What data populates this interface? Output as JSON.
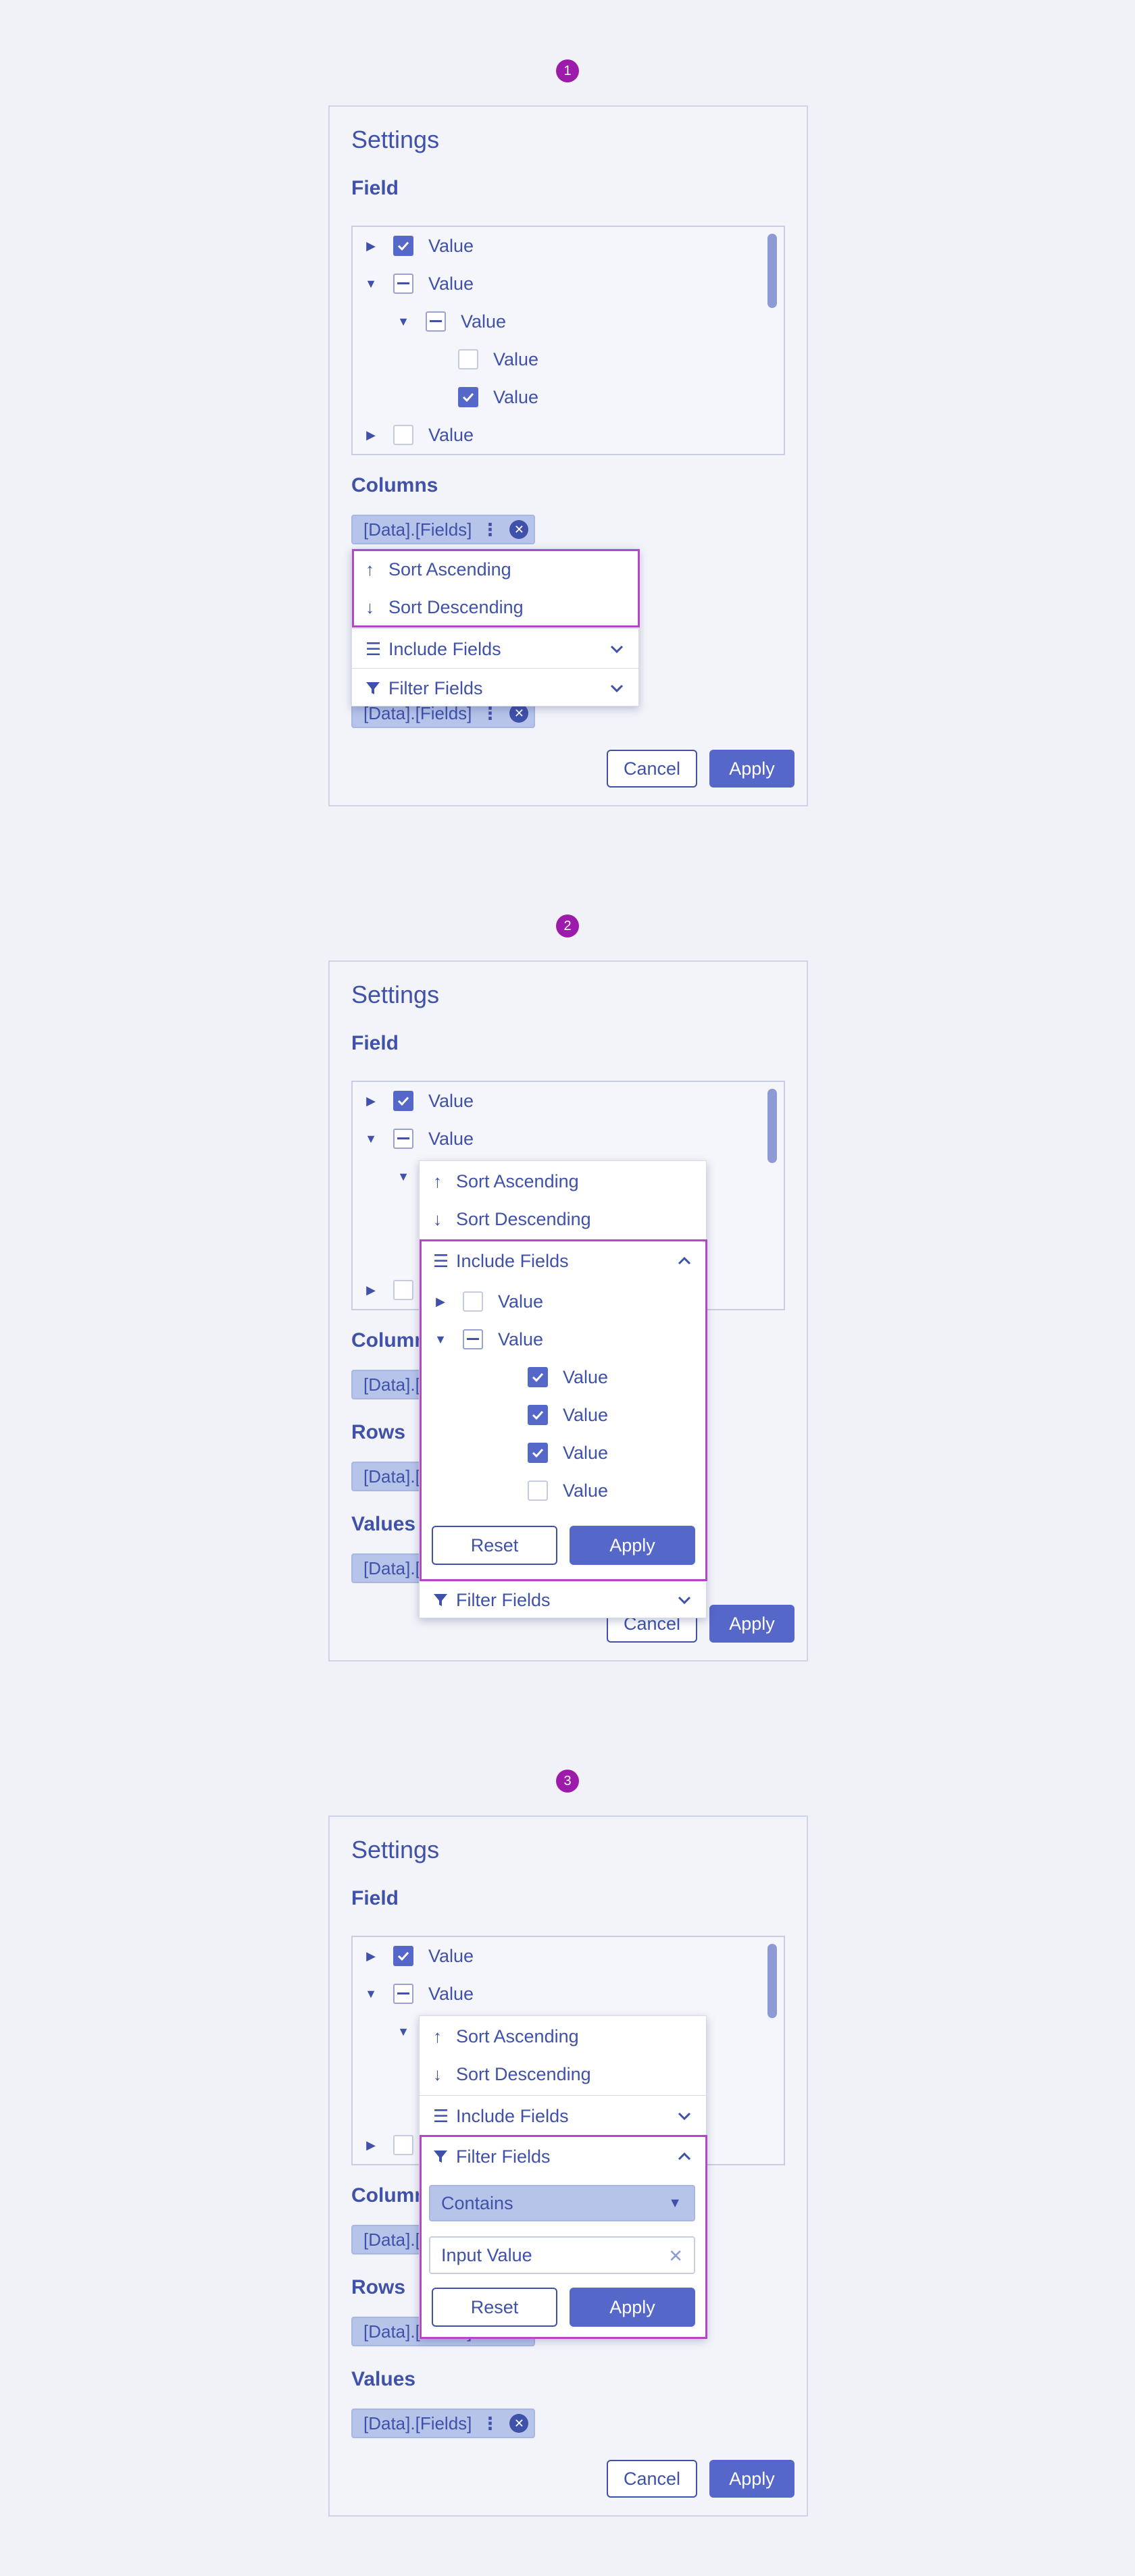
{
  "steps": [
    "1",
    "2",
    "3"
  ],
  "panel": {
    "title": "Settings",
    "field_label": "Field",
    "columns_label": "Columns",
    "rows_label": "Rows",
    "values_label": "Values",
    "cancel_label": "Cancel",
    "apply_label": "Apply"
  },
  "field_tree": [
    {
      "label": "Value",
      "caret": "right",
      "state": "checked",
      "level": 0
    },
    {
      "label": "Value",
      "caret": "down",
      "state": "partial",
      "level": 0
    },
    {
      "label": "Value",
      "caret": "down",
      "state": "partial",
      "level": 1
    },
    {
      "label": "Value",
      "caret": "none",
      "state": "unchecked",
      "level": 2
    },
    {
      "label": "Value",
      "caret": "none",
      "state": "checked",
      "level": 2
    },
    {
      "label": "Value",
      "caret": "right",
      "state": "unchecked",
      "level": 0
    }
  ],
  "chip_label": "[Data].[Fields]",
  "menu": {
    "sort_asc": "Sort Ascending",
    "sort_desc": "Sort Descending",
    "include_fields": "Include Fields",
    "filter_fields": "Filter Fields"
  },
  "include_tree": [
    {
      "label": "Value",
      "caret": "right",
      "state": "unchecked",
      "level": 0
    },
    {
      "label": "Value",
      "caret": "down",
      "state": "partial",
      "level": 0
    },
    {
      "label": "Value",
      "caret": "none",
      "state": "checked",
      "level": 1
    },
    {
      "label": "Value",
      "caret": "none",
      "state": "checked",
      "level": 1
    },
    {
      "label": "Value",
      "caret": "none",
      "state": "checked",
      "level": 1
    },
    {
      "label": "Value",
      "caret": "none",
      "state": "unchecked",
      "level": 1
    }
  ],
  "filter": {
    "condition": "Contains",
    "input_value": "Input Value",
    "reset_label": "Reset",
    "apply_label": "Apply"
  },
  "colors": {
    "accent": "#5567c9",
    "text": "#3f51a8",
    "highlight": "#b347c4",
    "badge": "#9c1bab",
    "chip": "#b6c4ea"
  }
}
